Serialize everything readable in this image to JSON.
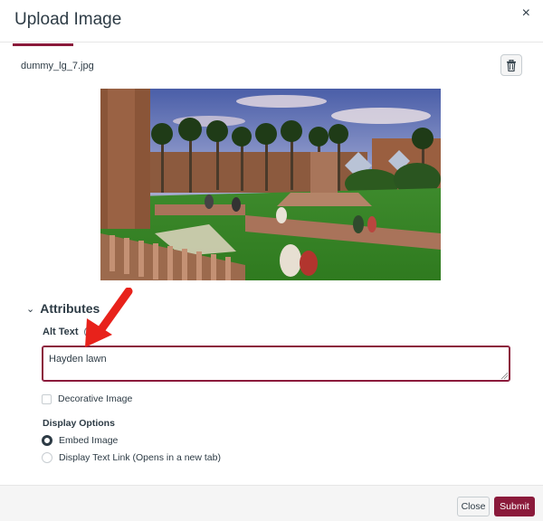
{
  "dialog": {
    "title": "Upload Image",
    "close_glyph": "×"
  },
  "file": {
    "name": "dummy_lg_7.jpg",
    "delete_icon": "trash-icon"
  },
  "attributes": {
    "section_label": "Attributes",
    "expanded": true,
    "alt_text": {
      "label": "Alt Text",
      "help_glyph": "?",
      "value": "Hayden lawn"
    },
    "decorative": {
      "label": "Decorative Image",
      "checked": false
    },
    "display_options": {
      "label": "Display Options",
      "options": [
        {
          "label": "Embed Image",
          "selected": true
        },
        {
          "label": "Display Text Link (Opens in a new tab)",
          "selected": false
        }
      ]
    }
  },
  "footer": {
    "close_label": "Close",
    "submit_label": "Submit"
  },
  "colors": {
    "accent": "#8b1a3b",
    "annotation_arrow": "#e8221b"
  }
}
